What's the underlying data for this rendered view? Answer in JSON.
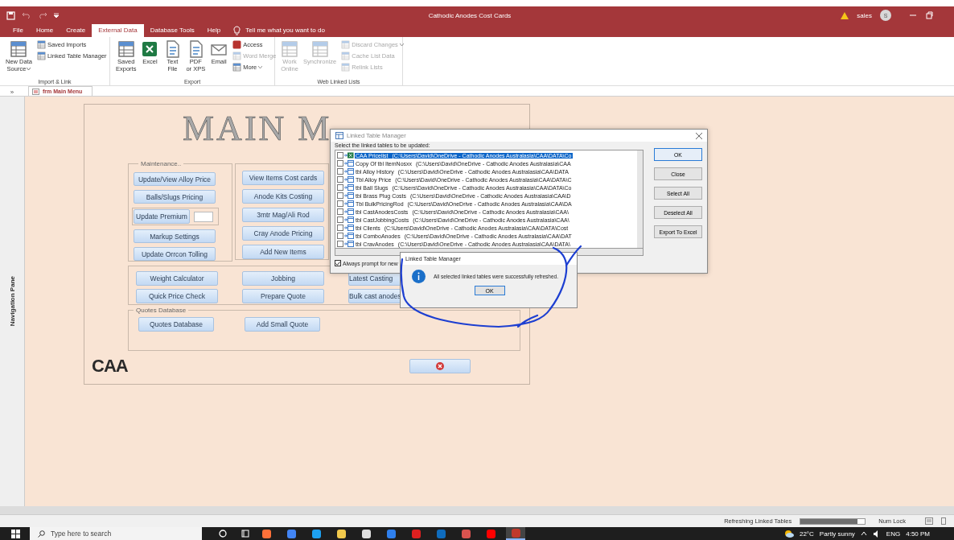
{
  "window": {
    "title": "Cathodic Anodes Cost Cards",
    "user": "sales",
    "user_initial": "S"
  },
  "tabs": [
    {
      "label": "File",
      "selected": false
    },
    {
      "label": "Home",
      "selected": false
    },
    {
      "label": "Create",
      "selected": false
    },
    {
      "label": "External Data",
      "selected": true
    },
    {
      "label": "Database Tools",
      "selected": false
    },
    {
      "label": "Help",
      "selected": false
    }
  ],
  "tell_me": "Tell me what you want to do",
  "ribbon": {
    "groups": [
      {
        "label": "Import & Link",
        "commands": [
          {
            "kind": "large",
            "lines": [
              "New Data",
              "Source"
            ],
            "dropdown": true,
            "disabled": false
          },
          {
            "kind": "small",
            "lines": [
              "Saved Imports"
            ],
            "dropdown": false,
            "disabled": false
          },
          {
            "kind": "small",
            "lines": [
              "Linked Table Manager"
            ],
            "dropdown": false,
            "disabled": false
          }
        ]
      },
      {
        "label": "Export",
        "commands": [
          {
            "kind": "large",
            "lines": [
              "Saved",
              "Exports"
            ],
            "dropdown": false,
            "disabled": false
          },
          {
            "kind": "large",
            "lines": [
              "Excel"
            ],
            "dropdown": false,
            "disabled": false
          },
          {
            "kind": "large",
            "lines": [
              "Text",
              "File"
            ],
            "dropdown": false,
            "disabled": false
          },
          {
            "kind": "large",
            "lines": [
              "PDF",
              "or XPS"
            ],
            "dropdown": false,
            "disabled": false
          },
          {
            "kind": "large",
            "lines": [
              "Email"
            ],
            "dropdown": false,
            "disabled": false
          },
          {
            "kind": "small",
            "lines": [
              "Access"
            ],
            "dropdown": false,
            "disabled": false
          },
          {
            "kind": "small",
            "lines": [
              "Word Merge"
            ],
            "dropdown": false,
            "disabled": true
          },
          {
            "kind": "small",
            "lines": [
              "More"
            ],
            "dropdown": true,
            "disabled": false
          }
        ]
      },
      {
        "label": "Web Linked Lists",
        "commands": [
          {
            "kind": "large",
            "lines": [
              "Work",
              "Online"
            ],
            "dropdown": false,
            "disabled": true
          },
          {
            "kind": "large",
            "lines": [
              "Synchronize"
            ],
            "dropdown": false,
            "disabled": true
          },
          {
            "kind": "small",
            "lines": [
              "Discard Changes"
            ],
            "dropdown": true,
            "disabled": true
          },
          {
            "kind": "small",
            "lines": [
              "Cache List Data"
            ],
            "dropdown": false,
            "disabled": true
          },
          {
            "kind": "small",
            "lines": [
              "Relink Lists"
            ],
            "dropdown": false,
            "disabled": true
          }
        ]
      }
    ]
  },
  "nav_toggle": "»",
  "document_tabs": [
    {
      "label": "frm Main Menu",
      "selected": true
    }
  ],
  "navigation_pane": "Navigation Pane",
  "form": {
    "heading": "MAIN M",
    "maintenance": {
      "legend": "Maintenance..",
      "buttons": [
        "Update/View Alloy Price",
        "Balls/Slugs Pricing",
        "Update Premium",
        "Markup Settings",
        "Update Orrcon Tolling"
      ]
    },
    "items": {
      "buttons": [
        "View Items Cost cards",
        "Anode Kits Costing",
        "3mtr Mag/Ali Rod",
        "Cray Anode Pricing",
        "Add New Items"
      ]
    },
    "tools": {
      "columns": [
        [
          "Weight Calculator",
          "Quick Price Check"
        ],
        [
          "Jobbing",
          "Prepare Quote"
        ],
        [
          "Latest Casting",
          "Bulk cast anodes"
        ]
      ]
    },
    "quotes": {
      "legend": "Quotes Database",
      "buttons": [
        "Quotes Database",
        "Add Small Quote"
      ]
    },
    "logo": "CAA"
  },
  "dialog": {
    "title": "Linked Table Manager",
    "prompt": "Select the linked tables to be updated:",
    "tables": [
      {
        "kind": "excel",
        "name": "CAA Pricelist",
        "path": "(C:\\Users\\David\\OneDrive - Cathodic Anodes Australasia\\CAA\\DATA\\Co",
        "checked": false,
        "selected": true
      },
      {
        "kind": "table",
        "name": "Copy Of tbl ItemNosxx",
        "path": "(C:\\Users\\David\\OneDrive - Cathodic Anodes Australasia\\CAA",
        "checked": false,
        "selected": false
      },
      {
        "kind": "table",
        "name": "tbl Alloy History",
        "path": "(C:\\Users\\David\\OneDrive - Cathodic Anodes Australasia\\CAA\\DATA",
        "checked": false,
        "selected": false
      },
      {
        "kind": "table",
        "name": "Tbl Alloy Price",
        "path": "(C:\\Users\\David\\OneDrive - Cathodic Anodes Australasia\\CAA\\DATA\\C",
        "checked": false,
        "selected": false
      },
      {
        "kind": "table",
        "name": "tbl Ball Slugs",
        "path": "(C:\\Users\\David\\OneDrive - Cathodic Anodes Australasia\\CAA\\DATA\\Co",
        "checked": false,
        "selected": false
      },
      {
        "kind": "table",
        "name": "tbl Brass Plug Costs",
        "path": "(C:\\Users\\David\\OneDrive - Cathodic Anodes Australasia\\CAA\\D",
        "checked": false,
        "selected": false
      },
      {
        "kind": "table",
        "name": "Tbl BulkPricingRod",
        "path": "(C:\\Users\\David\\OneDrive - Cathodic Anodes Australasia\\CAA\\DA",
        "checked": false,
        "selected": false
      },
      {
        "kind": "table",
        "name": "tbl CastAnodesCosts",
        "path": "(C:\\Users\\David\\OneDrive - Cathodic Anodes Australasia\\CAA\\",
        "checked": false,
        "selected": false
      },
      {
        "kind": "table",
        "name": "tbl CastJobbingCosts",
        "path": "(C:\\Users\\David\\OneDrive - Cathodic Anodes Australasia\\CAA\\",
        "checked": false,
        "selected": false
      },
      {
        "kind": "table",
        "name": "tbl Clients",
        "path": "(C:\\Users\\David\\OneDrive - Cathodic Anodes Australasia\\CAA\\DATA\\Cost",
        "checked": false,
        "selected": false
      },
      {
        "kind": "table",
        "name": "tbl ComboAnodes",
        "path": "(C:\\Users\\David\\OneDrive - Cathodic Anodes Australasia\\CAA\\DAT",
        "checked": false,
        "selected": false
      },
      {
        "kind": "table",
        "name": "tbl CravAnodes",
        "path": "(C:\\Users\\David\\OneDrive - Cathodic Anodes Australasia\\CAA\\DATA\\",
        "checked": false,
        "selected": false
      }
    ],
    "always_prompt": {
      "label": "Always prompt for new",
      "checked": true
    },
    "buttons": [
      {
        "label": "OK",
        "default": true
      },
      {
        "label": "Close",
        "default": false
      },
      {
        "label": "Select All",
        "default": false
      },
      {
        "label": "Deselect All",
        "default": false
      },
      {
        "label": "Export To Excel",
        "default": false
      }
    ]
  },
  "message_box": {
    "title": "Linked Table Manager",
    "message": "All selected linked tables were successfully refreshed.",
    "ok": "OK"
  },
  "status_bar": {
    "message": "Refreshing Linked Tables",
    "level": 0.88,
    "num_lock": "Num Lock"
  },
  "taskbar": {
    "search_placeholder": "Type here to search",
    "apps": [
      {
        "selected": false
      },
      {
        "selected": false
      },
      {
        "selected": false
      },
      {
        "selected": false
      },
      {
        "selected": false
      },
      {
        "selected": false
      },
      {
        "selected": false
      },
      {
        "selected": false
      },
      {
        "selected": false
      },
      {
        "selected": false
      },
      {
        "selected": true
      }
    ],
    "temperature": "22°C",
    "weather": "Partly sunny",
    "language": "ENG",
    "time": "4:50 PM"
  }
}
